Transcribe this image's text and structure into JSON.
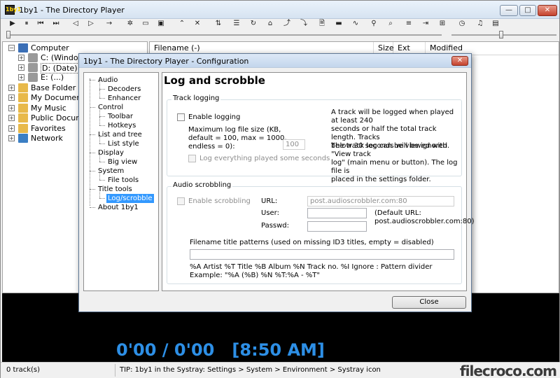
{
  "window": {
    "title": "1by1 - The Directory Player",
    "app_icon": "1by1",
    "min_icon": "minimize-icon",
    "max_icon": "maximize-icon",
    "close_icon": "close-icon",
    "min_glyph": "—",
    "max_glyph": "□",
    "close_glyph": "✕"
  },
  "toolbar": [
    {
      "name": "play-icon",
      "glyph": "▶"
    },
    {
      "name": "pause-icon",
      "glyph": "⏸"
    },
    {
      "name": "prev-track-icon",
      "glyph": "⏮"
    },
    {
      "name": "next-track-icon",
      "glyph": "⏭"
    },
    {
      "name": "folder-back-icon",
      "glyph": "◁"
    },
    {
      "name": "folder-forward-icon",
      "glyph": "▷"
    },
    {
      "name": "arrow-right-icon",
      "glyph": "→"
    },
    {
      "name": "gear-icon",
      "glyph": "✲"
    },
    {
      "name": "window-icon",
      "glyph": "▭"
    },
    {
      "name": "window-split-icon",
      "glyph": "▣"
    },
    {
      "name": "chevron-up-icon",
      "glyph": "⌃"
    },
    {
      "name": "close-x-icon",
      "glyph": "✕"
    },
    {
      "name": "sort-icon",
      "glyph": "⇅"
    },
    {
      "name": "panel-icon",
      "glyph": "☰"
    },
    {
      "name": "refresh-icon",
      "glyph": "↻"
    },
    {
      "name": "home-icon",
      "glyph": "⌂"
    },
    {
      "name": "up-folder-icon",
      "glyph": "⤴"
    },
    {
      "name": "down-folder-icon",
      "glyph": "⤵"
    },
    {
      "name": "document-icon",
      "glyph": "🗎"
    },
    {
      "name": "tag-icon",
      "glyph": "▬"
    },
    {
      "name": "waveform-icon",
      "glyph": "∿"
    },
    {
      "name": "search-icon",
      "glyph": "⚲"
    },
    {
      "name": "search-folder-icon",
      "glyph": "⌕"
    },
    {
      "name": "list-settings-icon",
      "glyph": "≡"
    },
    {
      "name": "mark-icon",
      "glyph": "⇥"
    },
    {
      "name": "grid-icon",
      "glyph": "⊞"
    },
    {
      "name": "clock-icon",
      "glyph": "◷"
    },
    {
      "name": "equalizer-icon",
      "glyph": "♫"
    },
    {
      "name": "playlist-icon",
      "glyph": "▤"
    }
  ],
  "tree": [
    {
      "name": "tree-item-computer",
      "label": "Computer",
      "icon": "computer-icon",
      "expander": "−"
    },
    {
      "name": "tree-item-drive-c",
      "label": "C: (Windows)",
      "icon": "drive-icon",
      "expander": "+"
    },
    {
      "name": "tree-item-drive-d",
      "label": "D: (Date)",
      "icon": "drive-icon",
      "expander": "+"
    },
    {
      "name": "tree-item-drive-e",
      "label": "E: (...)",
      "icon": "drive-icon",
      "expander": "+"
    },
    {
      "name": "tree-item-base-folder",
      "label": "Base Folder",
      "icon": "folder-icon",
      "expander": "+"
    },
    {
      "name": "tree-item-my-documents",
      "label": "My Documents",
      "icon": "folder-icon",
      "expander": "+"
    },
    {
      "name": "tree-item-my-music",
      "label": "My Music",
      "icon": "folder-icon",
      "expander": "+"
    },
    {
      "name": "tree-item-public-documents",
      "label": "Public Documer",
      "icon": "folder-icon",
      "expander": "+"
    },
    {
      "name": "tree-item-favorites",
      "label": "Favorites",
      "icon": "folder-icon",
      "expander": "+"
    },
    {
      "name": "tree-item-network",
      "label": "Network",
      "icon": "network-icon",
      "expander": "+"
    }
  ],
  "file_list": {
    "columns": [
      "Filename (-)",
      "Size",
      "Ext",
      "Modified"
    ]
  },
  "player": {
    "time": "0'00 / 0'00   [8:50 AM]"
  },
  "status": {
    "tracks": "0 track(s)",
    "tip": "TIP: 1by1 in the Systray: Settings > System > Environment > Systray icon",
    "watermark": "filecroco.com"
  },
  "dialog": {
    "title": "1by1 - The Directory Player - Configuration",
    "close_glyph": "✕",
    "nav": [
      {
        "name": "nav-audio",
        "label": "Audio",
        "level": 0
      },
      {
        "name": "nav-decoders",
        "label": "Decoders",
        "level": 1
      },
      {
        "name": "nav-enhancer",
        "label": "Enhancer",
        "level": 1
      },
      {
        "name": "nav-control",
        "label": "Control",
        "level": 0
      },
      {
        "name": "nav-toolbar",
        "label": "Toolbar",
        "level": 1
      },
      {
        "name": "nav-hotkeys",
        "label": "Hotkeys",
        "level": 1
      },
      {
        "name": "nav-list-and-tree",
        "label": "List and tree",
        "level": 0
      },
      {
        "name": "nav-list-style",
        "label": "List style",
        "level": 1
      },
      {
        "name": "nav-display",
        "label": "Display",
        "level": 0
      },
      {
        "name": "nav-big-view",
        "label": "Big view",
        "level": 1
      },
      {
        "name": "nav-system",
        "label": "System",
        "level": 0
      },
      {
        "name": "nav-file-tools",
        "label": "File tools",
        "level": 1
      },
      {
        "name": "nav-title-tools",
        "label": "Title tools",
        "level": 0
      },
      {
        "name": "nav-log-scrobble",
        "label": "Log/scrobble",
        "level": 1,
        "selected": true
      },
      {
        "name": "nav-about",
        "label": "About 1by1",
        "level": 0
      }
    ],
    "page_title": "Log and scrobble",
    "track_logging": {
      "group_title": "Track logging",
      "enable_label": "Enable logging",
      "max_size_label": "Maximum log file size (KB,\ndefault = 100, max = 1000,\nendless = 0):",
      "max_size_value": "100",
      "log_all_label": "Log everything played some seconds",
      "info1": "A track will be logged when played at least 240\nseconds or half the total track length. Tracks\nbelow 30 seconds will be ignored.",
      "info2": "The track log can be viewed with \"View track\nlog\" (main menu or button). The log file is\nplaced in the settings folder."
    },
    "audio_scrobbling": {
      "group_title": "Audio scrobbling",
      "enable_label": "Enable scrobbling",
      "url_label": "URL:",
      "url_value": "post.audioscrobbler.com:80",
      "user_label": "User:",
      "user_value": "",
      "pass_label": "Passwd:",
      "pass_value": "",
      "default_url_note": "(Default URL:\npost.audioscrobbler.com:80)",
      "patterns_label": "Filename title patterns (used on missing ID3 titles, empty = disabled)",
      "patterns_value": "",
      "legend": "%A  Artist    %T  Title    %B  Album    %N  Track no.    %I  Ignore    :  Pattern divider",
      "example": "Example: \"%A (%B) %N %T:%A - %T\""
    },
    "close_button": "Close"
  }
}
